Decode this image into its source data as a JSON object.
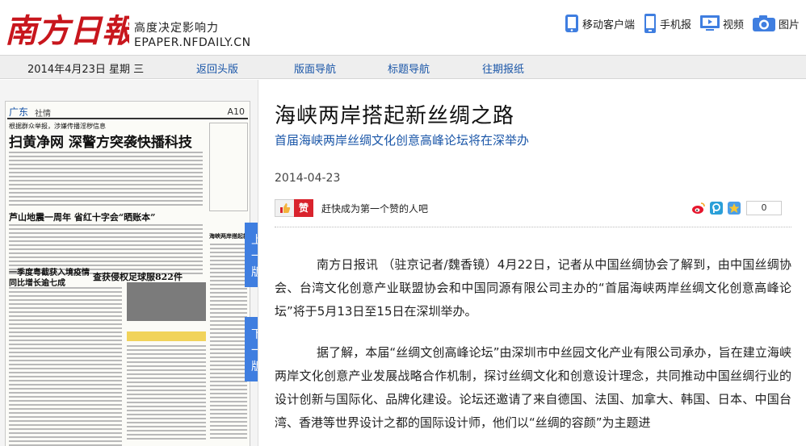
{
  "header": {
    "logo_text": "南方日報",
    "slogan": "高度决定影响力",
    "site_url": "EPAPER.NFDAILY.CN",
    "links": [
      {
        "label": "移动客户端",
        "icon": "mobile-client-icon"
      },
      {
        "label": "手机报",
        "icon": "phone-icon"
      },
      {
        "label": "视频",
        "icon": "video-icon"
      },
      {
        "label": "图片",
        "icon": "camera-icon"
      }
    ]
  },
  "nav": {
    "date": "2014年4月23日 星期 三",
    "items": [
      "返回头版",
      "版面导航",
      "标题导航",
      "往期报纸"
    ]
  },
  "paper": {
    "section": "广东",
    "section_sub": "社情",
    "page_no": "A10",
    "headlines": {
      "h1": "扫黄净网 深警方突袭快播科技",
      "h1_kicker": "根据群众举报，涉嫌传播淫秽信息",
      "h2": "芦山地震一周年 省红十字会“晒账本”",
      "h3": "一季度粤截获入境疫情",
      "h3b": "同比增长逾七成",
      "h4": "查获侵权足球服822件",
      "h5": "海峡两岸搭起新丝绸之路"
    },
    "prev_label": [
      "上",
      "一",
      "版"
    ],
    "next_label": [
      "下",
      "一",
      "版"
    ]
  },
  "article": {
    "title": "海峡两岸搭起新丝绸之路",
    "subtitle": "首届海峡两岸丝绸文化创意高峰论坛将在深举办",
    "date": "2014-04-23",
    "like_label": "赞",
    "like_hint": "赶快成为第一个赞的人吧",
    "share_count": "0",
    "paragraphs": [
      "南方日报讯 （驻京记者/魏香镜）4月22日，记者从中国丝绸协会了解到，由中国丝绸协会、台湾文化创意产业联盟协会和中国同源有限公司主办的“首届海峡两岸丝绸文化创意高峰论坛”将于5月13日至15日在深圳举办。",
      "据了解，本届“丝绸文创高峰论坛”由深圳市中丝园文化产业有限公司承办，旨在建立海峡两岸文化创意产业发展战略合作机制，探讨丝绸文化和创意设计理念，共同推动中国丝绸行业的设计创新与国际化、品牌化建设。论坛还邀请了来自德国、法国、加拿大、韩国、日本、中国台湾、香港等世界设计之都的国际设计师，他们以“丝绸的容颜”为主题进"
    ]
  },
  "colors": {
    "logo_red": "#c8161d",
    "link_blue": "#1a56a8",
    "page_button": "#3f7ee0",
    "like_red": "#d9232d"
  }
}
